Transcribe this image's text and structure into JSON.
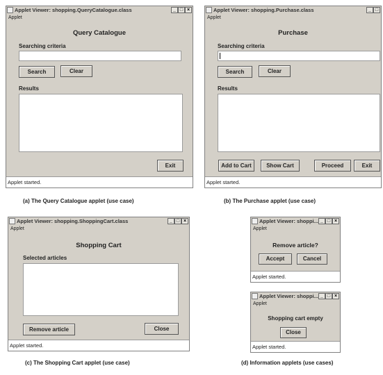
{
  "window_controls": {
    "minimize": "_",
    "maximize": "□",
    "close": "×"
  },
  "query_window": {
    "title": "Applet Viewer: shopping.QueryCatalogue.class",
    "menu": "Applet",
    "heading": "Query Catalogue",
    "criteria_label": "Searching criteria",
    "search_button": "Search",
    "clear_button": "Clear",
    "results_label": "Results",
    "exit_button": "Exit",
    "status": "Applet started."
  },
  "purchase_window": {
    "title": "Applet Viewer: shopping.Purchase.class",
    "menu": "Applet",
    "heading": "Purchase",
    "criteria_label": "Searching criteria",
    "search_button": "Search",
    "clear_button": "Clear",
    "results_label": "Results",
    "add_to_cart_button": "Add to Cart",
    "show_cart_button": "Show Cart",
    "proceed_button": "Proceed",
    "exit_button": "Exit",
    "status": "Applet started."
  },
  "cart_window": {
    "title": "Applet Viewer: shopping.ShoppingCart.class",
    "menu": "Applet",
    "heading": "Shopping Cart",
    "selected_label": "Selected articles",
    "remove_button": "Remove article",
    "close_button": "Close",
    "status": "Applet started."
  },
  "remove_dialog": {
    "title": "Applet Viewer: shoppi...",
    "menu": "Applet",
    "message": "Remove article?",
    "accept_button": "Accept",
    "cancel_button": "Cancel",
    "status": "Applet started."
  },
  "empty_dialog": {
    "title": "Applet Viewer: shoppi...",
    "menu": "Applet",
    "message": "Shopping cart empty",
    "close_button": "Close",
    "status": "Applet started."
  },
  "captions": {
    "a": "(a) The Query Catalogue applet (use case)",
    "b": "(b) The Purchase applet (use case)",
    "c": "(c) The Shopping Cart applet (use case)",
    "d": "(d) Information applets (use cases)"
  }
}
